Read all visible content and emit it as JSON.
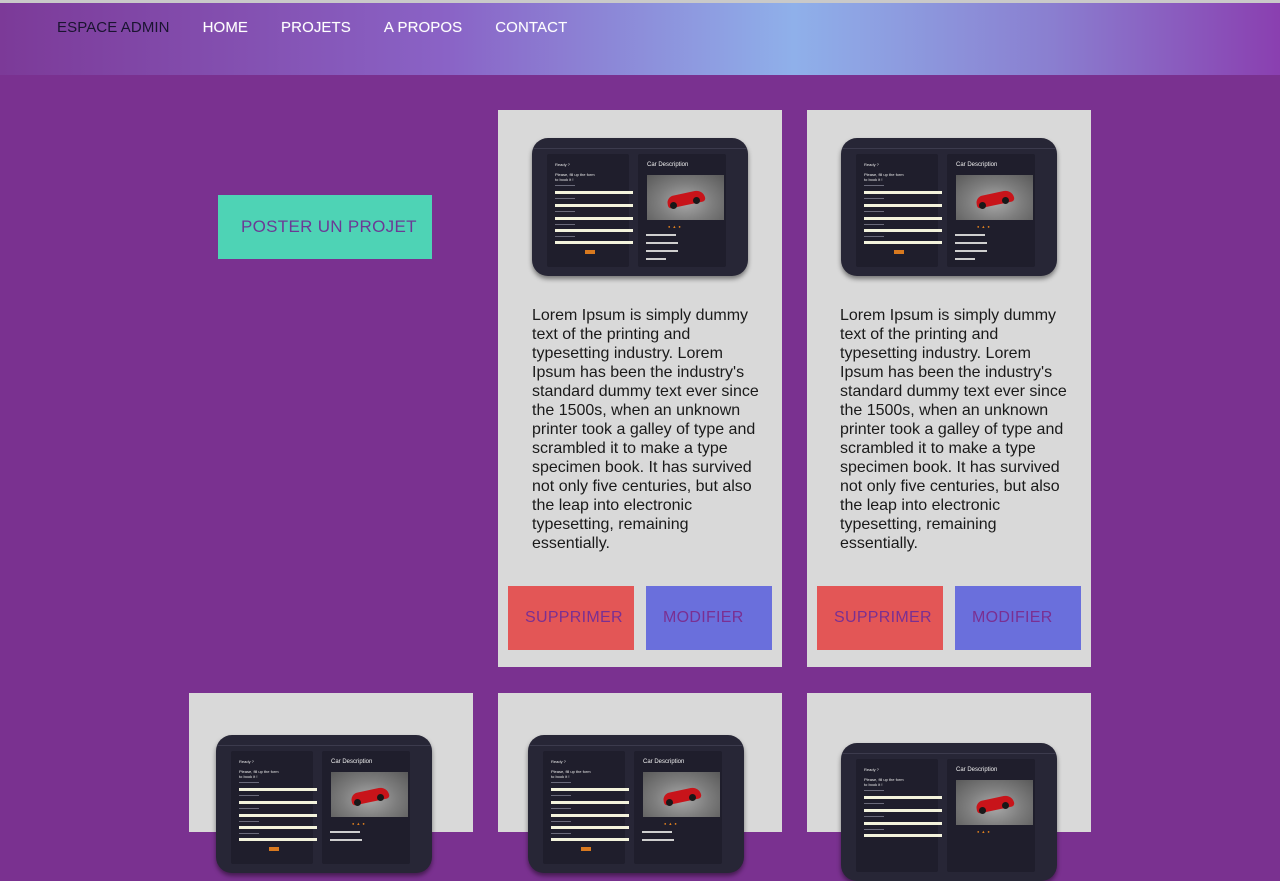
{
  "nav": {
    "brand": "ESPACE ADMIN",
    "items": [
      "HOME",
      "PROJETS",
      "A PROPOS",
      "CONTACT"
    ]
  },
  "post_button": "POSTER UN PROJET",
  "thumbnail": {
    "form_title": "Ready ?",
    "form_subtitle": "Please, fill up the form",
    "form_subtitle2": "to book it !",
    "desc_title": "Car Description"
  },
  "cards": [
    {
      "description": "Lorem Ipsum is simply dummy text of the printing and typesetting industry. Lorem Ipsum has been the industry's standard dummy text ever since the 1500s, when an unknown printer took a galley of type and scrambled it to make a type specimen book. It has survived not only five centuries, but also the leap into electronic typesetting, remaining essentially.",
      "delete_label": "SUPPRIMER",
      "edit_label": "MODIFIER"
    },
    {
      "description": "Lorem Ipsum is simply dummy text of the printing and typesetting industry. Lorem Ipsum has been the industry's standard dummy text ever since the 1500s, when an unknown printer took a galley of type and scrambled it to make a type specimen book. It has survived not only five centuries, but also the leap into electronic typesetting, remaining essentially.",
      "delete_label": "SUPPRIMER",
      "edit_label": "MODIFIER"
    }
  ],
  "colors": {
    "background": "#7a3190",
    "card": "#d9d9d9",
    "post_button": "#4ed3b5",
    "delete_button": "#e35656",
    "edit_button": "#6a6fdc",
    "button_text": "#7a2f92"
  }
}
